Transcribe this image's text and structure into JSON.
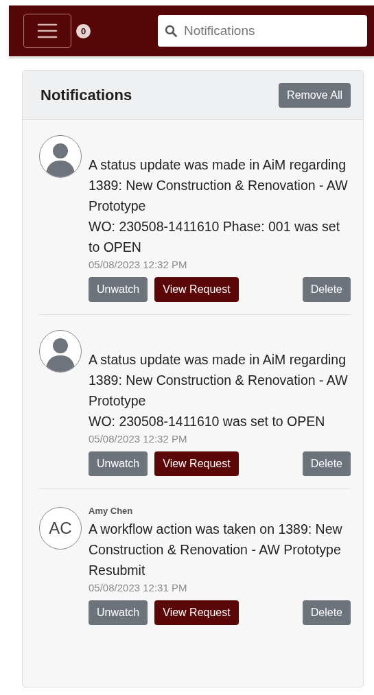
{
  "header": {
    "badge": "0",
    "search": {
      "placeholder": "Notifications"
    }
  },
  "panel": {
    "title": "Notifications",
    "remove_all": "Remove All"
  },
  "notifications": [
    {
      "avatar": {
        "kind": "silhouette"
      },
      "message": [
        "A status update was made in AiM regarding 1389: New Construction & Renovation - AW Prototype",
        "WO: 230508-1411610 Phase: 001 was set to OPEN"
      ],
      "time": "05/08/2023 12:32 PM",
      "buttons": [
        "Unwatch",
        "View Request",
        "Delete"
      ]
    },
    {
      "avatar": {
        "kind": "silhouette"
      },
      "message": [
        "A status update was made in AiM regarding 1389: New Construction & Renovation - AW Prototype",
        "WO: 230508-1411610 was set to OPEN"
      ],
      "time": "05/08/2023 12:32 PM",
      "buttons": [
        "Unwatch",
        "View Request",
        "Delete"
      ]
    },
    {
      "avatar": {
        "kind": "initials",
        "text": "AC"
      },
      "author": "Amy Chen",
      "message": [
        "A workflow action was taken on 1389: New Construction & Renovation - AW Prototype",
        "Resubmit"
      ],
      "time": "05/08/2023 12:31 PM",
      "buttons": [
        "Unwatch",
        "View Request",
        "Delete"
      ]
    }
  ]
}
